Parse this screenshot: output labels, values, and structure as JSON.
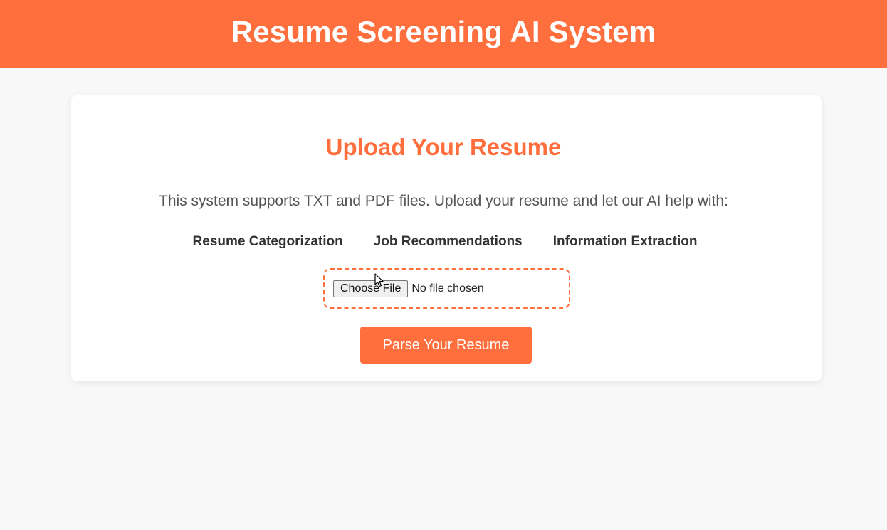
{
  "header": {
    "title": "Resume Screening AI System"
  },
  "card": {
    "title": "Upload Your Resume",
    "intro": "This system supports TXT and PDF files. Upload your resume and let our AI help with:",
    "features": [
      "Resume Categorization",
      "Job Recommendations",
      "Information Extraction"
    ],
    "file_input": {
      "button_label": "Choose File",
      "status": "No file chosen"
    },
    "submit_label": "Parse Your Resume"
  },
  "colors": {
    "accent": "#ff6e3d",
    "background": "#f8f8f8",
    "card": "#ffffff"
  },
  "icons": {
    "cursor": "mouse-pointer-icon"
  }
}
